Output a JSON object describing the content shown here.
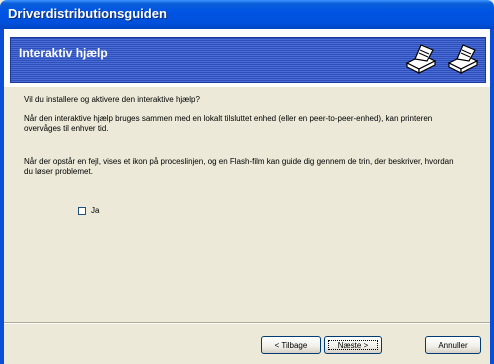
{
  "window": {
    "title": "Driverdistributionsguiden"
  },
  "banner": {
    "title": "Interaktiv hjælp",
    "icons": [
      "printer-icon",
      "printer-icon"
    ]
  },
  "content": {
    "question": "Vil du installere og aktivere den interaktive hjælp?",
    "paragraph1": "Når den interaktive hjælp bruges sammen med en lokalt tilsluttet enhed (eller en peer-to-peer-enhed), kan printeren overvåges til enhver tid.",
    "paragraph2": "Når der opstår en fejl, vises et ikon på proceslinjen, og en Flash-film kan guide dig gennem de trin, der beskriver, hvordan du løser problemet.",
    "checkbox": {
      "label": "Ja",
      "checked": false
    }
  },
  "buttons": {
    "back": "< Tilbage",
    "next": "Næste >",
    "cancel": "Annuller"
  }
}
